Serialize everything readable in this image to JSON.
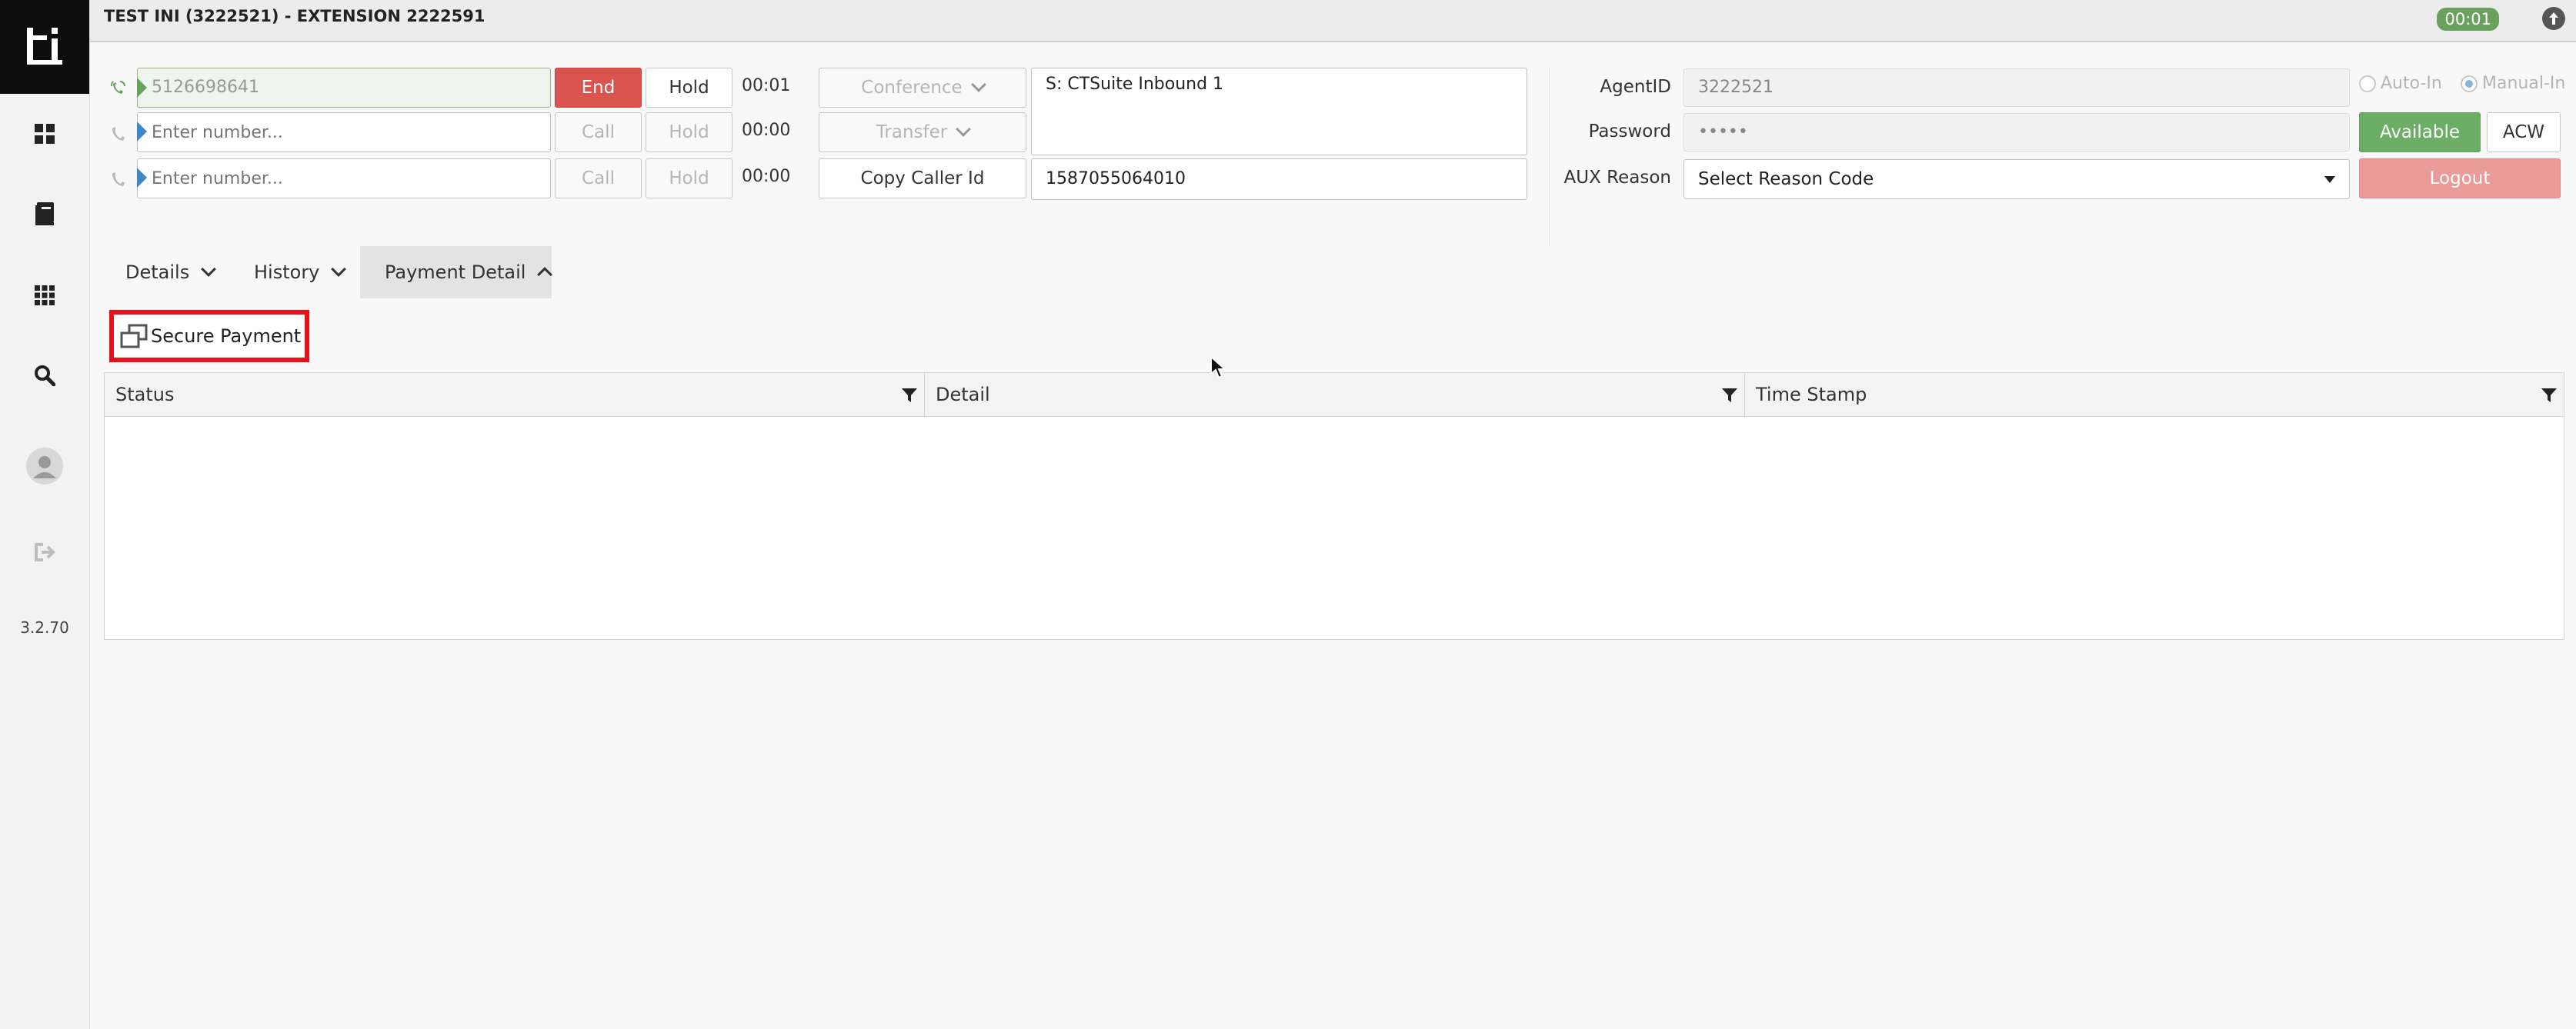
{
  "header": {
    "title": "TEST INI (3222521) - EXTENSION 2222591",
    "session_timer": "00:01"
  },
  "sidebar": {
    "version": "3.2.70",
    "items": [
      "dashboard-icon",
      "book-icon",
      "apps-grid-icon",
      "search-icon",
      "user-avatar-icon",
      "logout-icon"
    ]
  },
  "lines": [
    {
      "number_value": "5126698641",
      "primary_label": "End",
      "hold_label": "Hold",
      "timer": "00:01",
      "active": true
    },
    {
      "placeholder": "Enter number...",
      "primary_label": "Call",
      "hold_label": "Hold",
      "timer": "00:00",
      "active": false
    },
    {
      "placeholder": "Enter number...",
      "primary_label": "Call",
      "hold_label": "Hold",
      "timer": "00:00",
      "active": false
    }
  ],
  "call_controls": {
    "conference_label": "Conference",
    "transfer_label": "Transfer",
    "copy_caller_id_label": "Copy Caller Id",
    "call_info": "S: CTSuite Inbound 1",
    "caller_id": "1587055064010"
  },
  "agent": {
    "agent_id_label": "AgentID",
    "agent_id_value": "3222521",
    "password_label": "Password",
    "password_value": "•••••",
    "aux_reason_label": "AUX Reason",
    "aux_reason_value": "Select Reason Code",
    "auto_in_label": "Auto-In",
    "manual_in_label": "Manual-In",
    "selected_mode": "Manual-In",
    "available_label": "Available",
    "acw_label": "ACW",
    "logout_label": "Logout"
  },
  "tabs": [
    {
      "label": "Details",
      "expanded": false
    },
    {
      "label": "History",
      "expanded": false
    },
    {
      "label": "Payment Detail",
      "expanded": true
    }
  ],
  "payment": {
    "secure_payment_label": "Secure Payment",
    "columns": [
      "Status",
      "Detail",
      "Time Stamp"
    ],
    "rows": []
  },
  "colors": {
    "end": "#d9534f",
    "available": "#6cae65",
    "logout": "#ea9a98",
    "highlight": "#e8111a",
    "line_active": "#6aa15e",
    "line_idle": "#3f88c5"
  }
}
